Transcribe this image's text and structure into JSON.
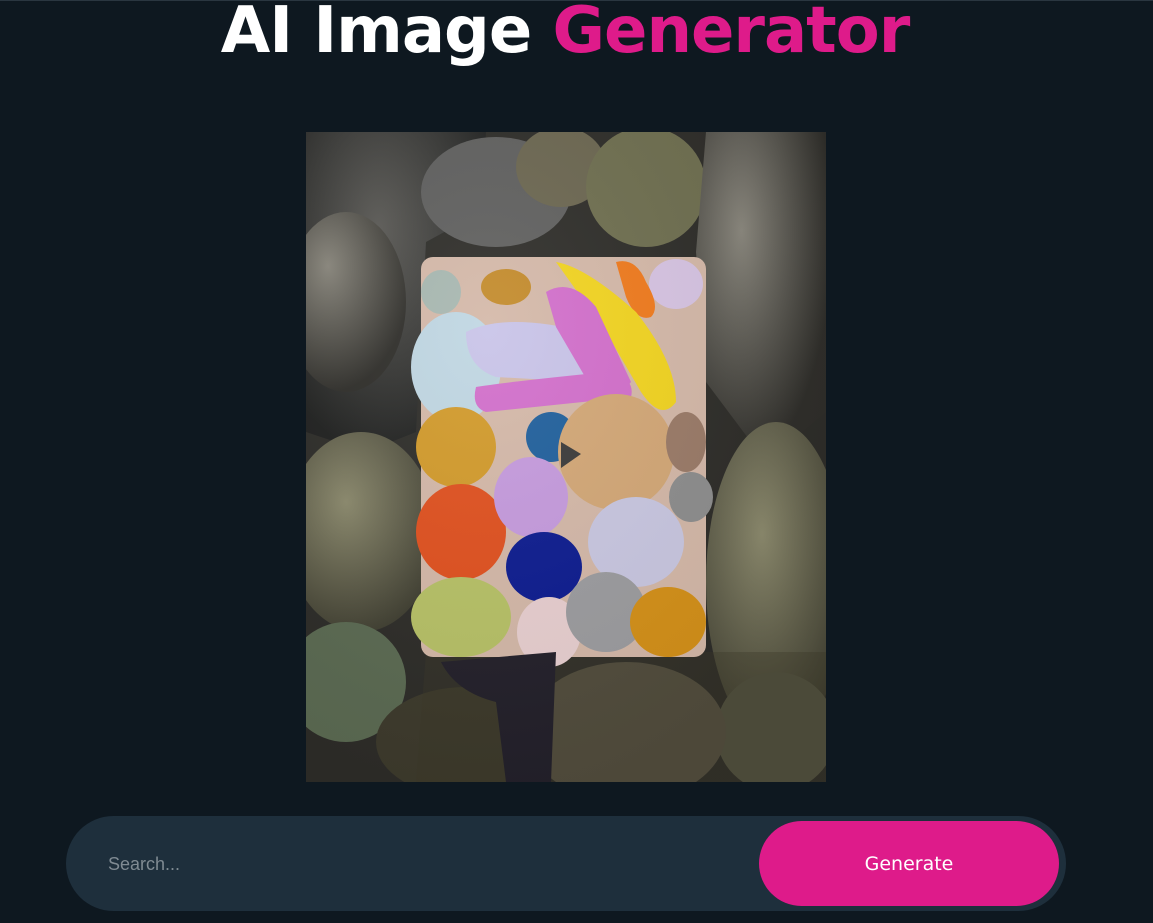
{
  "header": {
    "title_main": "AI Image",
    "title_accent": "Generator",
    "accent_color": "#de1b8a"
  },
  "generated_image": {
    "description_icon": "abstract-3d-shapes-image"
  },
  "search": {
    "placeholder": "Search...",
    "value": ""
  },
  "actions": {
    "generate_label": "Generate"
  },
  "colors": {
    "background": "#0e1820",
    "search_bar": "#1e2f3c",
    "button": "#de1b8a",
    "text": "#ffffff"
  }
}
